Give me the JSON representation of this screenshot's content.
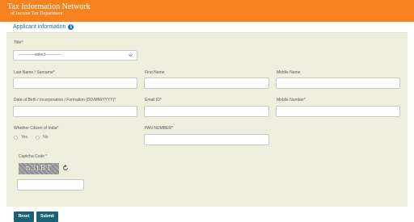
{
  "header": {
    "title": "Tax Information Network",
    "subtitle": "of Income Tax Department"
  },
  "section": {
    "title": "Applicant information",
    "info_icon": "i"
  },
  "form": {
    "title_label": "Title*",
    "title_value": "------------select------------",
    "last_name_label": "Last Name / Surname*",
    "first_name_label": "First Name",
    "middle_name_label": "Middle Name",
    "dob_label": "Date of Birth / Incorporation / Formation (DD/MM/YYYY)*",
    "email_label": "Email ID*",
    "mobile_label": "Mobile Number*",
    "citizen_label": "Whether Citizen of India*",
    "citizen_yes": "Yes",
    "citizen_no": "No",
    "pan_label": "PAN NUMBER*",
    "captcha_label": "Captcha Code *",
    "captcha_text": "n3tBT"
  },
  "buttons": {
    "reset": "Reset",
    "submit": "Submit"
  },
  "colors": {
    "header_bg": "#f5821f",
    "panel_bg": "#efefde",
    "button_bg": "#1a6277",
    "accent": "#1a6fb0"
  }
}
